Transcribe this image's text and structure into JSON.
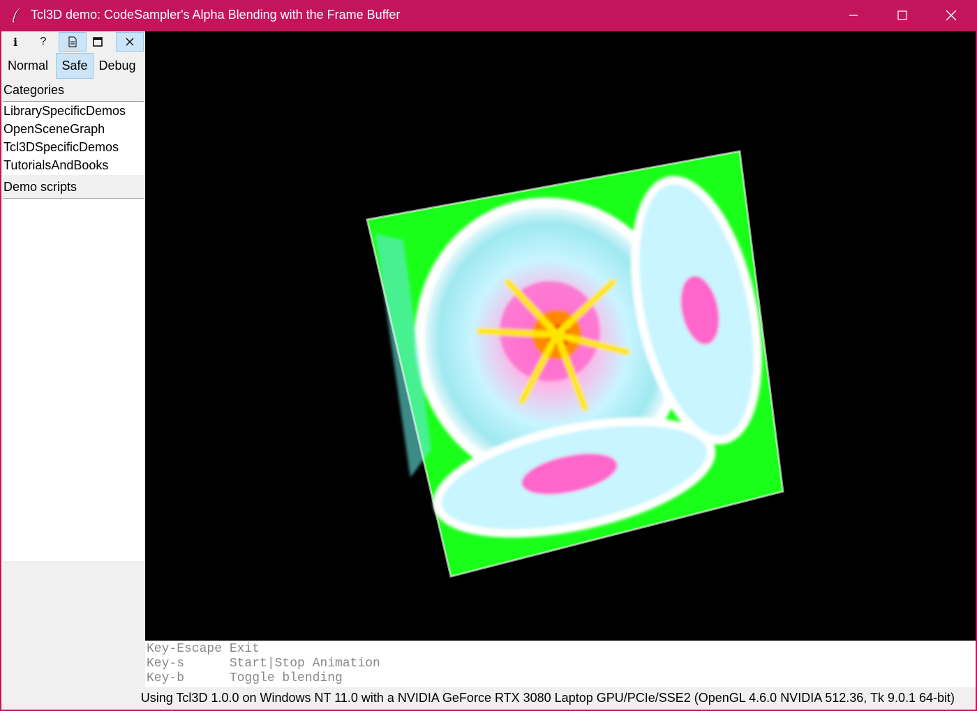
{
  "window": {
    "title": "Tcl3D demo: CodeSampler's Alpha Blending with the Frame Buffer",
    "accent": "#c4145c",
    "controls": [
      "minimize-icon",
      "maximize-icon",
      "close-icon"
    ]
  },
  "toolbar": {
    "info_label": "i",
    "help_label": "?",
    "buttons": [
      "info-icon",
      "help-icon",
      "document-icon",
      "window-icon",
      "close-icon"
    ]
  },
  "modes": {
    "normal": "Normal",
    "safe": "Safe",
    "debug": "Debug",
    "selected": "Safe"
  },
  "categories": {
    "label": "Categories",
    "items": [
      "LibrarySpecificDemos",
      "OpenSceneGraph",
      "Tcl3DSpecificDemos",
      "TutorialsAndBooks"
    ]
  },
  "scripts": {
    "label": "Demo scripts",
    "items": []
  },
  "console": {
    "lines": [
      "Key-Escape Exit",
      "Key-s      Start|Stop Animation",
      "Key-b      Toggle blending"
    ]
  },
  "status": {
    "text": "Using Tcl3D 1.0.0 on Windows NT 11.0 with a NVIDIA GeForce RTX 3080 Laptop GPU/PCIe/SSE2 (OpenGL 4.6.0 NVIDIA 512.36, Tk 9.0.1 64-bit)"
  },
  "colors": {
    "cube_face": "#1aff1a",
    "gl_background": "#000000",
    "selected_bg": "#cce4f7"
  }
}
